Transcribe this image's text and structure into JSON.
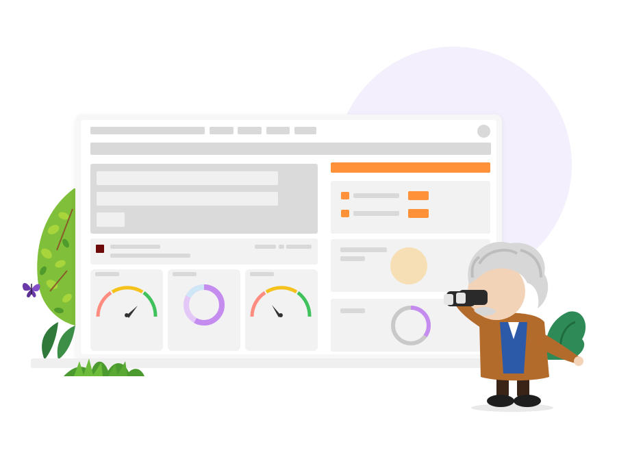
{
  "colors": {
    "accent_orange": "#ff9238",
    "wireframe_gray": "#d9d9d9",
    "panel_bg": "#f2f2f2",
    "lavender_circle": "#f4effc",
    "gauge_red": "#ff8c80",
    "gauge_yellow": "#f4c21b",
    "gauge_green": "#3fc15c",
    "donut_purple": "#c58cf0",
    "donut_lilac": "#e3c8f7",
    "donut_blue": "#cfe6f7",
    "donut_gray": "#c9c9c9",
    "peach_circle": "#f7dfb5",
    "marker_maroon": "#6e0a0a"
  },
  "illustration": {
    "character": "einstein-with-binoculars",
    "decorations": [
      "leafy-bush",
      "purple-butterfly",
      "grass-tuft",
      "green-shrub"
    ]
  },
  "dashboard": {
    "gauges": [
      {
        "name": "gauge-left",
        "level": 0.72
      },
      {
        "name": "gauge-right",
        "level": 0.3
      }
    ],
    "donuts": [
      {
        "name": "donut-center",
        "segments": [
          0.58,
          0.25,
          0.17
        ]
      },
      {
        "name": "donut-right-panel",
        "segments": [
          0.35,
          0.65
        ]
      }
    ]
  }
}
